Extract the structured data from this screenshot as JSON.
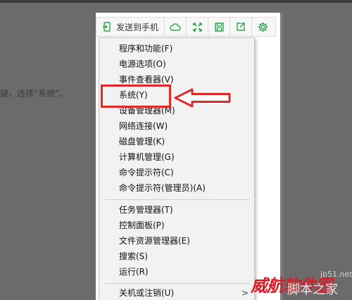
{
  "background": {
    "instruction_text": "键，选择“系统”。"
  },
  "toolbar": {
    "send_label": "发送到手机",
    "icons": [
      "send-to-phone-icon",
      "cloud-icon",
      "fullscreen-icon",
      "save-icon",
      "share-icon",
      "gear-icon"
    ]
  },
  "menu": {
    "items": [
      "程序和功能(F)",
      "电源选项(O)",
      "事件查看器(V)",
      "系统(Y)",
      "设备管理器(M)",
      "网络连接(W)",
      "磁盘管理(K)",
      "计算机管理(G)",
      "命令提示符(C)",
      "命令提示符(管理员)(A)",
      "任务管理器(T)",
      "控制面板(P)",
      "文件资源管理器(E)",
      "搜索(S)",
      "运行(R)",
      "关机或注销(U)"
    ],
    "submenu_arrow": ">"
  },
  "watermarks": {
    "site_red": "威航软件园",
    "site_white": "脚本之家",
    "site_white_small": "jb51.net"
  },
  "colors": {
    "accent_green": "#2aa34a",
    "highlight_red": "#e12828",
    "menu_bg": "#f2f2f2"
  }
}
